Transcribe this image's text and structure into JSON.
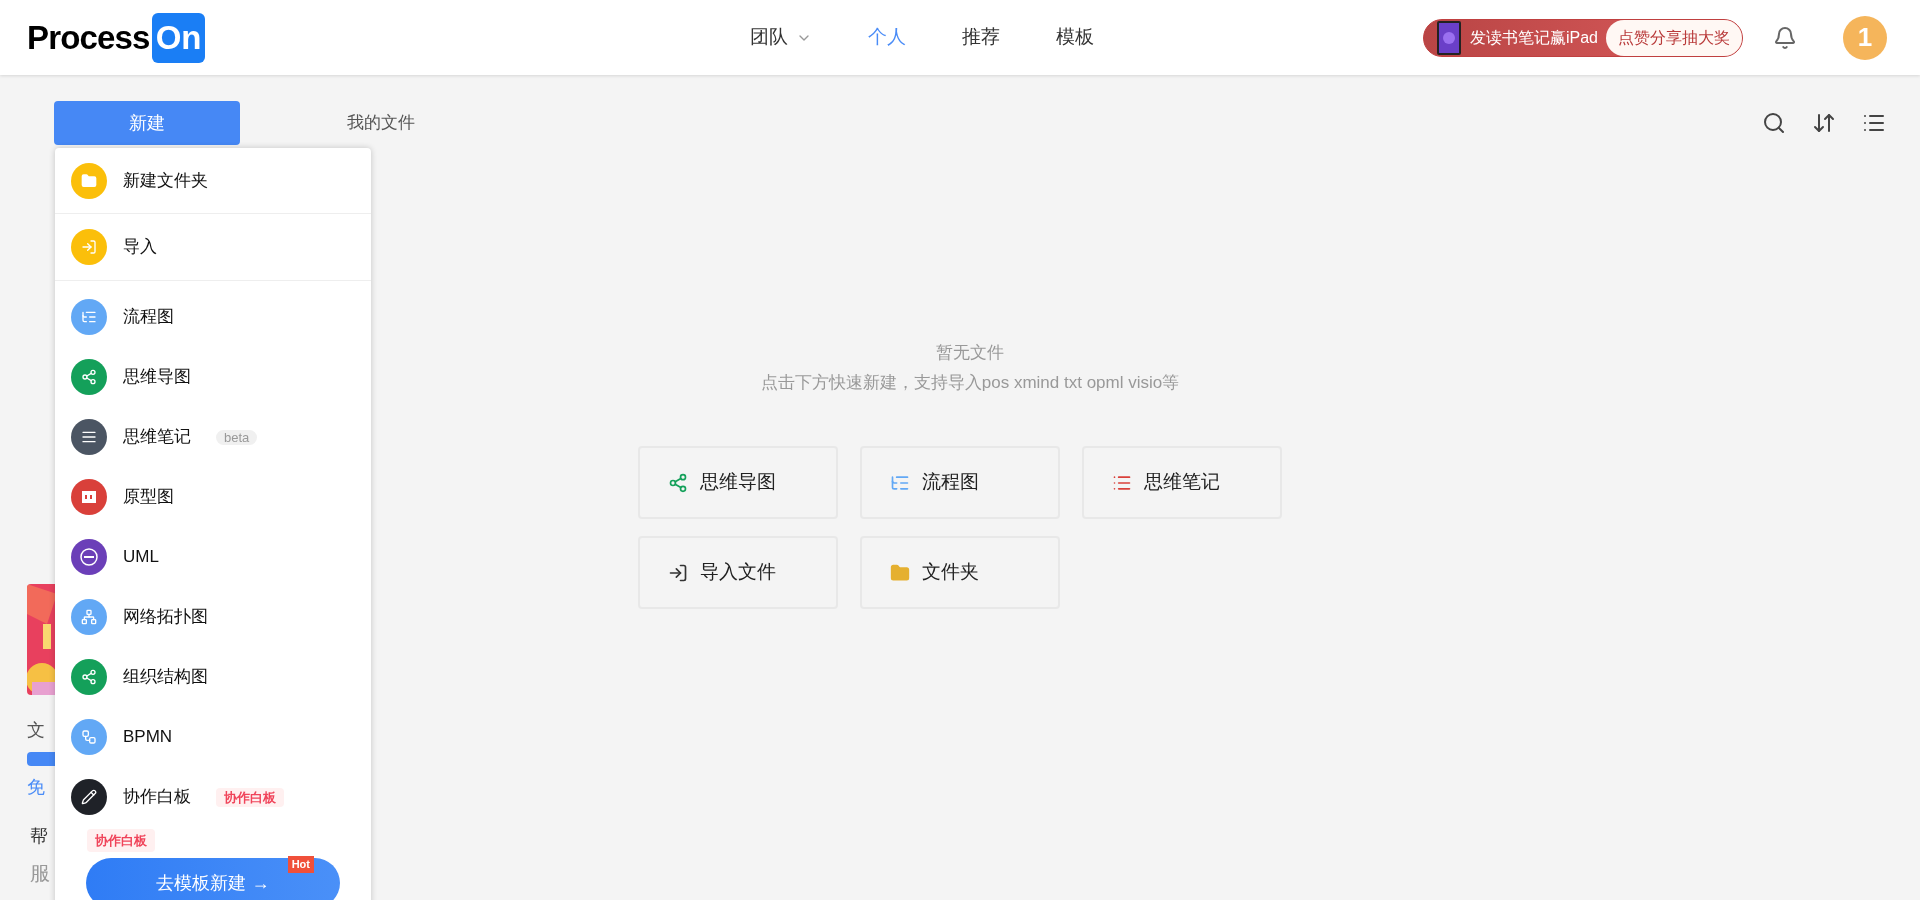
{
  "header": {
    "logo": {
      "text": "Process",
      "badge": "On"
    },
    "nav": [
      {
        "label": "团队",
        "selected": false,
        "dropdown": true
      },
      {
        "label": "个人",
        "selected": true,
        "dropdown": false
      },
      {
        "label": "推荐",
        "selected": false,
        "dropdown": false
      },
      {
        "label": "模板",
        "selected": false,
        "dropdown": false
      }
    ],
    "promo": {
      "left": "发读书笔记赢iPad",
      "right": "点赞分享抽大奖"
    },
    "avatar": "1"
  },
  "toolbar": {
    "new_button": "新建",
    "breadcrumb": "我的文件"
  },
  "sidebar": {
    "storage_label": "文",
    "plan_link": "免",
    "help": "帮",
    "service": "服"
  },
  "new_menu": {
    "top_items": [
      {
        "label": "新建文件夹",
        "color": "#fbbf0a"
      },
      {
        "label": "导入",
        "color": "#fbbf0a"
      }
    ],
    "items": [
      {
        "label": "流程图",
        "color": "#62a8f5"
      },
      {
        "label": "思维导图",
        "color": "#14a05a"
      },
      {
        "label": "思维笔记",
        "color": "#4b5563",
        "tag": {
          "text": "beta",
          "kind": "beta"
        }
      },
      {
        "label": "原型图",
        "color": "#d9403a"
      },
      {
        "label": "UML",
        "color": "#6b3fb8"
      },
      {
        "label": "网络拓扑图",
        "color": "#62a8f5"
      },
      {
        "label": "组织结构图",
        "color": "#14a05a"
      },
      {
        "label": "BPMN",
        "color": "#62a8f5"
      },
      {
        "label": "协作白板",
        "color": "#1f2228",
        "tag": {
          "text": "协作白板",
          "kind": "hot"
        }
      }
    ],
    "extra_tag": "协作白板",
    "template_button": "去模板新建 →",
    "hot_badge": "Hot"
  },
  "empty_state": {
    "title": "暂无文件",
    "hint": "点击下方快速新建，支持导入pos xmind txt opml visio等",
    "cards": [
      {
        "label": "思维导图"
      },
      {
        "label": "流程图"
      },
      {
        "label": "思维笔记"
      },
      {
        "label": "导入文件"
      },
      {
        "label": "文件夹"
      }
    ]
  }
}
